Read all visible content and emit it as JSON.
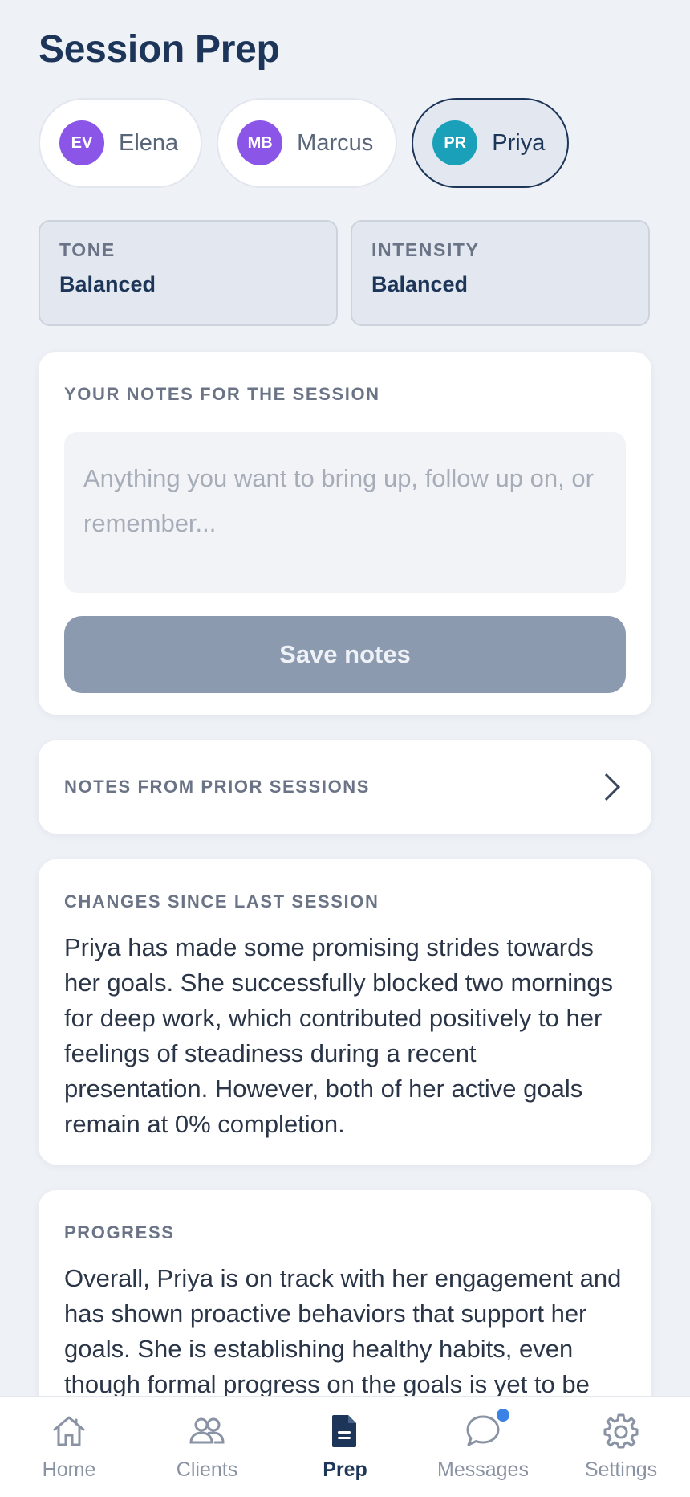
{
  "page": {
    "title": "Session Prep"
  },
  "clients": [
    {
      "initials": "EV",
      "name": "Elena",
      "color": "#8b55e8",
      "active": false
    },
    {
      "initials": "MB",
      "name": "Marcus",
      "color": "#8b55e8",
      "active": false
    },
    {
      "initials": "PR",
      "name": "Priya",
      "color": "#1aa0b8",
      "active": true
    }
  ],
  "settings": {
    "tone": {
      "label": "TONE",
      "value": "Balanced"
    },
    "intensity": {
      "label": "INTENSITY",
      "value": "Balanced"
    }
  },
  "notes": {
    "label": "YOUR NOTES FOR THE SESSION",
    "value": "",
    "placeholder": "Anything you want to bring up, follow up on, or remember...",
    "save_label": "Save notes"
  },
  "prior": {
    "label": "NOTES FROM PRIOR SESSIONS"
  },
  "changes": {
    "label": "CHANGES SINCE LAST SESSION",
    "text": "Priya has made some promising strides towards her goals. She successfully blocked two mornings for deep work, which contributed positively to her feelings of steadiness during a recent presentation. However, both of her active goals remain at 0% completion."
  },
  "progress": {
    "label": "PROGRESS",
    "text": "Overall, Priya is on track with her engagement and has shown proactive behaviors that support her goals. She is establishing healthy habits, even though formal progress on the goals is yet to be"
  },
  "tabbar": {
    "items": [
      {
        "label": "Home",
        "icon": "home-icon"
      },
      {
        "label": "Clients",
        "icon": "clients-icon"
      },
      {
        "label": "Prep",
        "icon": "document-icon",
        "active": true
      },
      {
        "label": "Messages",
        "icon": "chat-icon",
        "badge": true
      },
      {
        "label": "Settings",
        "icon": "gear-icon"
      }
    ]
  },
  "colors": {
    "accent": "#1c3558",
    "badge": "#3b82e6",
    "disabled_button": "#8c9aaf"
  }
}
